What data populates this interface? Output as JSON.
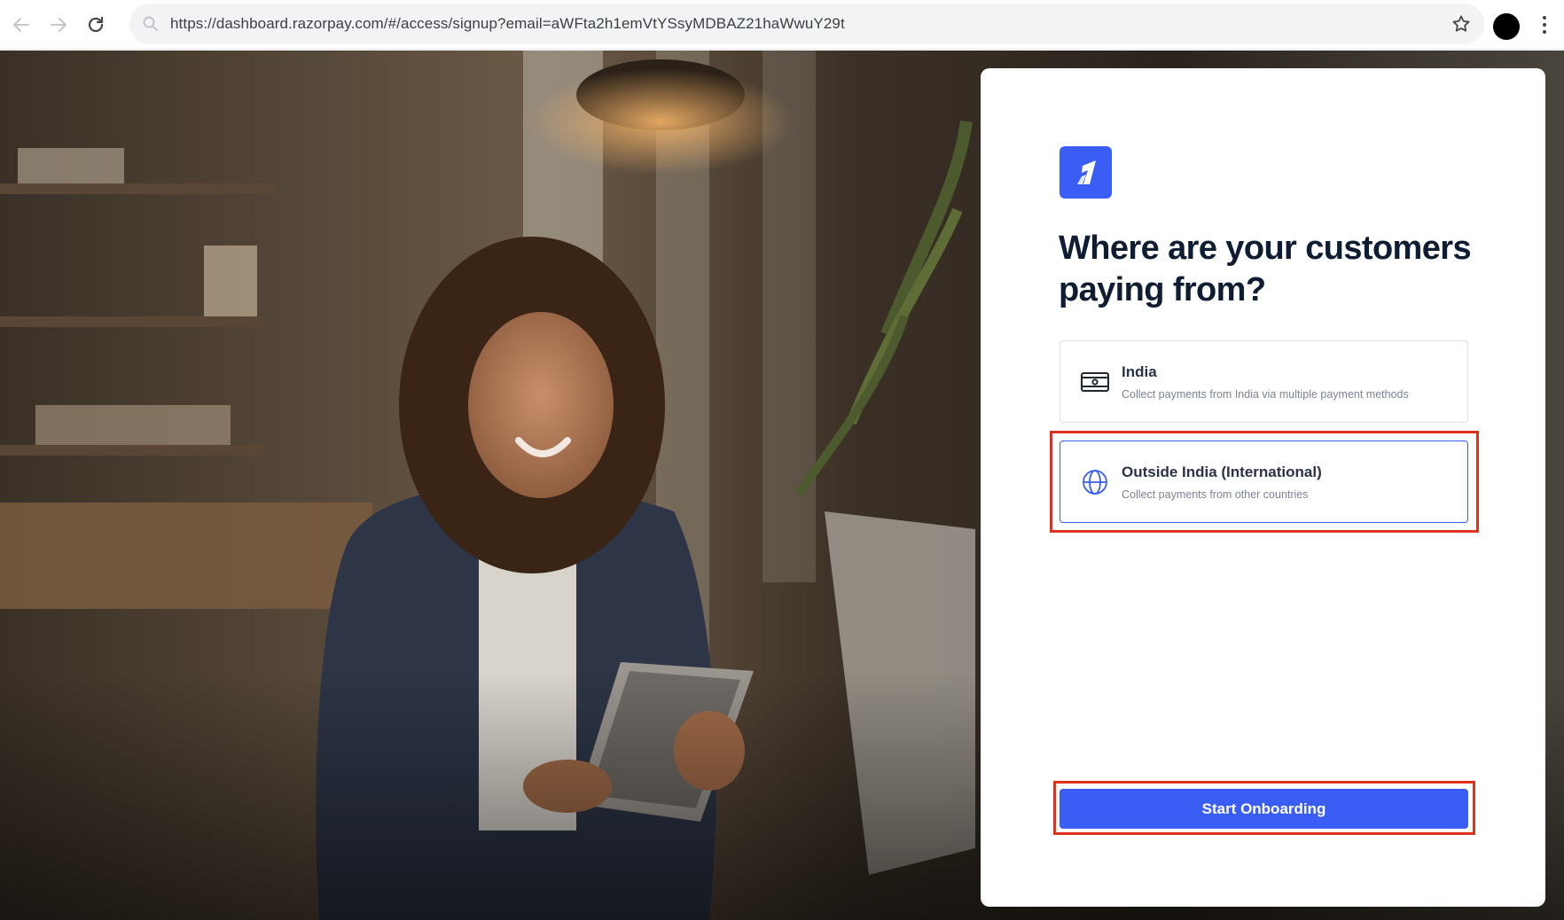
{
  "browser": {
    "url": "https://dashboard.razorpay.com/#/access/signup?email=aWFta2h1emVtYSsyMDBAZ21haWwuY29t",
    "icons": [
      "back-arrow-icon",
      "forward-arrow-icon",
      "reload-icon",
      "search-icon",
      "star-icon",
      "profile-avatar",
      "kebab-menu-icon"
    ]
  },
  "card": {
    "heading": "Where are your customers paying from?",
    "options": [
      {
        "id": "india",
        "title": "India",
        "subtitle": "Collect payments from India via multiple payment methods",
        "icon": "banknote-icon",
        "selected": false
      },
      {
        "id": "international",
        "title": "Outside India (International)",
        "subtitle": "Collect payments from other countries",
        "icon": "globe-icon",
        "selected": true
      }
    ],
    "cta_label": "Start Onboarding"
  },
  "colors": {
    "brand_blue": "#3a5ef5",
    "heading_text": "#0f1d33",
    "highlight_red": "#e0301e"
  }
}
